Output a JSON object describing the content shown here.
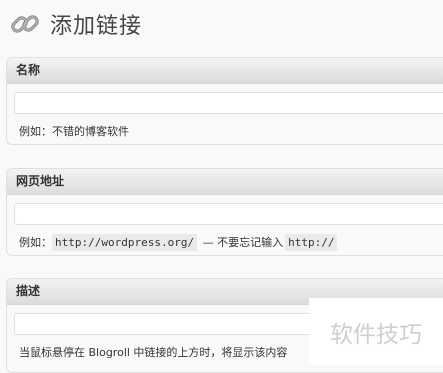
{
  "page": {
    "title": "添加链接"
  },
  "name_box": {
    "heading": "名称",
    "input_value": "",
    "hint": "例如：不错的博客软件"
  },
  "url_box": {
    "heading": "网页地址",
    "input_value": "",
    "hint_prefix": "例如：",
    "hint_example": "http://wordpress.org/",
    "hint_sep": "— 不要忘记输入",
    "hint_code": "http://"
  },
  "desc_box": {
    "heading": "描述",
    "input_value": "",
    "hint": "当鼠标悬停在 Blogroll 中链接的上方时，将显示该内容"
  },
  "watermark": {
    "text": "软件技巧"
  },
  "icons": {
    "title_icon": "link-icon"
  }
}
